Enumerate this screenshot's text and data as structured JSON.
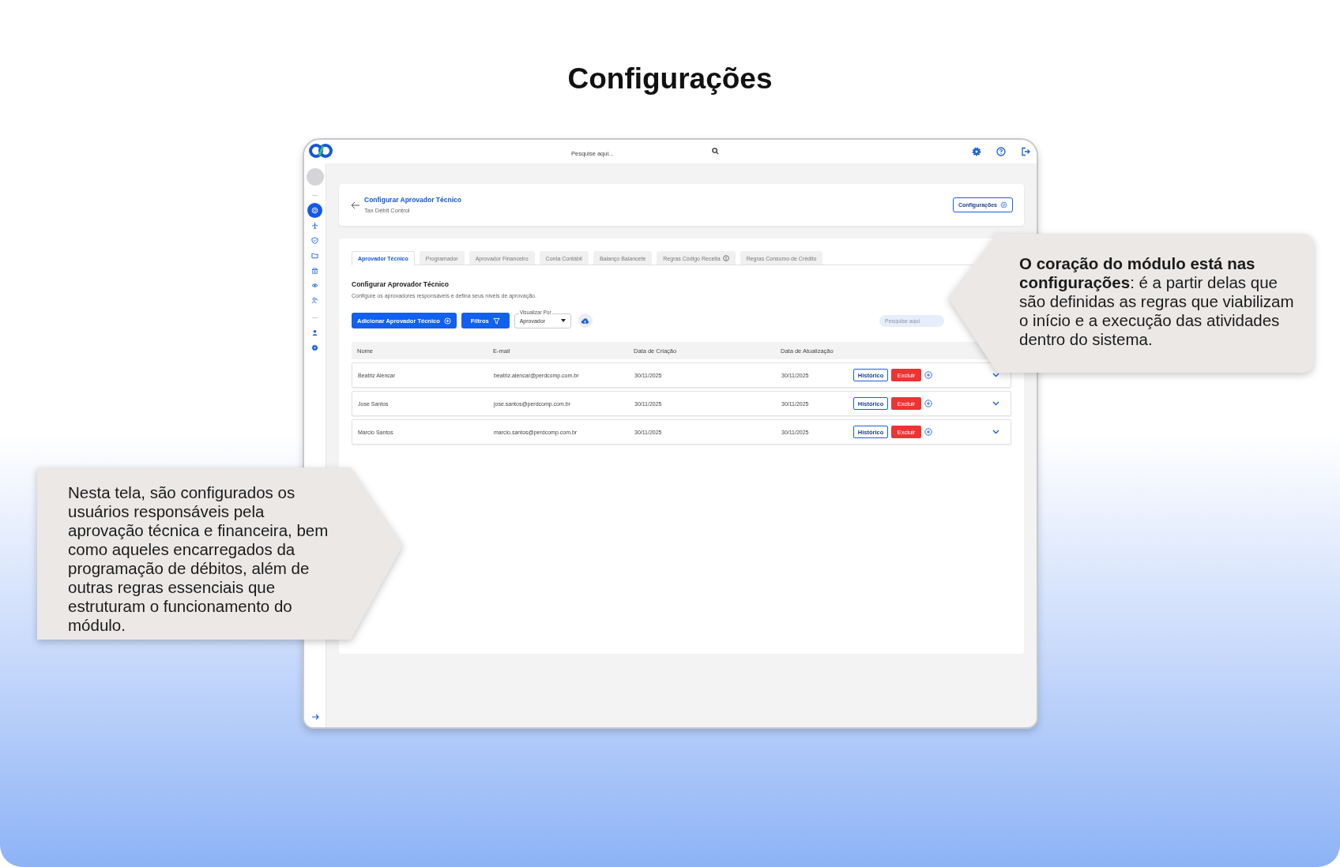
{
  "heading": "Configurações",
  "app": {
    "search": {
      "placeholder": "Pesquise aqui..."
    },
    "sidebar": {
      "items": [
        {
          "selected": true
        },
        {
          "selected": false
        },
        {
          "selected": false
        },
        {
          "selected": false
        },
        {
          "selected": false
        },
        {
          "selected": false
        },
        {
          "selected": false
        },
        {
          "selected": false
        },
        {
          "selected": false
        }
      ]
    },
    "page_header": {
      "title": "Configurar Aprovador Técnico",
      "subtitle": "Tax Débit Control",
      "button": "Configurações"
    },
    "tabs": [
      {
        "label": "Aprovador Técnico",
        "selected": true,
        "info": false
      },
      {
        "label": "Programador",
        "selected": false,
        "info": false
      },
      {
        "label": "Aprovador Financeiro",
        "selected": false,
        "info": false
      },
      {
        "label": "Conta Contábil",
        "selected": false,
        "info": false
      },
      {
        "label": "Balanço Balancete",
        "selected": false,
        "info": false
      },
      {
        "label": "Regras Código Receita",
        "selected": false,
        "info": true
      },
      {
        "label": "Regras Consumo de Crédito",
        "selected": false,
        "info": false
      }
    ],
    "section": {
      "title": "Configurar Aprovador Técnico",
      "description": "Configure os aprovadores responsáveis e defina seus níveis de aprovação."
    },
    "toolbar": {
      "add_button": "Adicionar Aprovador Técnico",
      "filter_button": "Filtros",
      "view_by": {
        "label": "Visualizar Por",
        "value": "Aprovador"
      },
      "search": {
        "placeholder": "Pesquise aqui"
      }
    },
    "table": {
      "columns": [
        "Nome",
        "E-mail",
        "Data de Criação",
        "Data de Atualização"
      ],
      "rows": [
        {
          "name": "Beatriz Alencar",
          "email": "beatriz.alencar@perdcomp.com.br",
          "created": "30/11/2025",
          "updated": "30/11/2025",
          "history_button": "Histórico",
          "delete_button": "Excluir"
        },
        {
          "name": "Jose Santos",
          "email": "jose.santos@perdcomp.com.br",
          "created": "30/11/2025",
          "updated": "30/11/2025",
          "history_button": "Histórico",
          "delete_button": "Excluir"
        },
        {
          "name": "Marcio Santos",
          "email": "marcio.santos@perdcomp.com.br",
          "created": "30/11/2025",
          "updated": "30/11/2025",
          "history_button": "Histórico",
          "delete_button": "Excluir"
        }
      ]
    }
  },
  "callouts": [
    {
      "text": "**O coração do módulo está nas configurações**: é a partir delas que são definidas as regras que viabilizam o início e a execução das atividades dentro do sistema."
    },
    {
      "text": "Nesta tela, são configurados os usuários responsáveis pela aprovação técnica e financeira, bem como aqueles encarregados da programação de débitos, além de outras regras essenciais que estruturam o funcionamento do módulo."
    }
  ]
}
